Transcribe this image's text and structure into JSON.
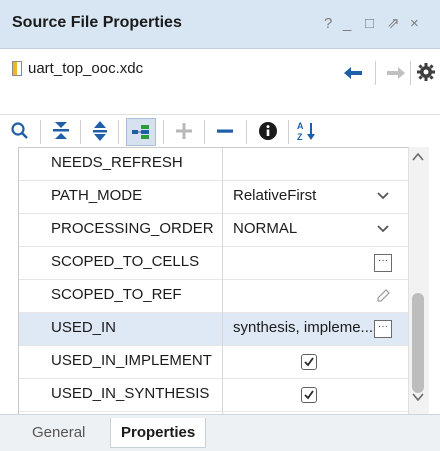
{
  "window": {
    "title": "Source File Properties",
    "controls": [
      "?",
      "_",
      "□",
      "⇗",
      "×"
    ]
  },
  "file": {
    "name": "uart_top_ooc.xdc",
    "icon": "xdc-file-icon"
  },
  "toolbar": {
    "icons": [
      "search-icon",
      "collapse-all-icon",
      "expand-icon",
      "group-by-icon",
      "add-icon",
      "remove-icon",
      "info-icon",
      "sort-az-icon"
    ]
  },
  "properties": [
    {
      "name": "NEEDS_REFRESH",
      "value": ""
    },
    {
      "name": "PATH_MODE",
      "value": "RelativeFirst",
      "control": "dropdown"
    },
    {
      "name": "PROCESSING_ORDER",
      "value": "NORMAL",
      "control": "dropdown"
    },
    {
      "name": "SCOPED_TO_CELLS",
      "value": "",
      "control": "ellipsis"
    },
    {
      "name": "SCOPED_TO_REF",
      "value": "",
      "control": "edit"
    },
    {
      "name": "USED_IN",
      "value": "synthesis, impleme...",
      "control": "ellipsis",
      "selected": true
    },
    {
      "name": "USED_IN_IMPLEMENT",
      "value": "",
      "control": "checkbox",
      "checked": true
    },
    {
      "name": "USED_IN_SYNTHESIS",
      "value": "",
      "control": "checkbox",
      "checked": true
    }
  ],
  "tabs": [
    {
      "label": "General",
      "active": false
    },
    {
      "label": "Properties",
      "active": true
    }
  ],
  "colors": {
    "title_bar_bg": "#d8e6f3",
    "selected_row_bg": "#dfe9f6",
    "accent": "#1f5fa8"
  }
}
